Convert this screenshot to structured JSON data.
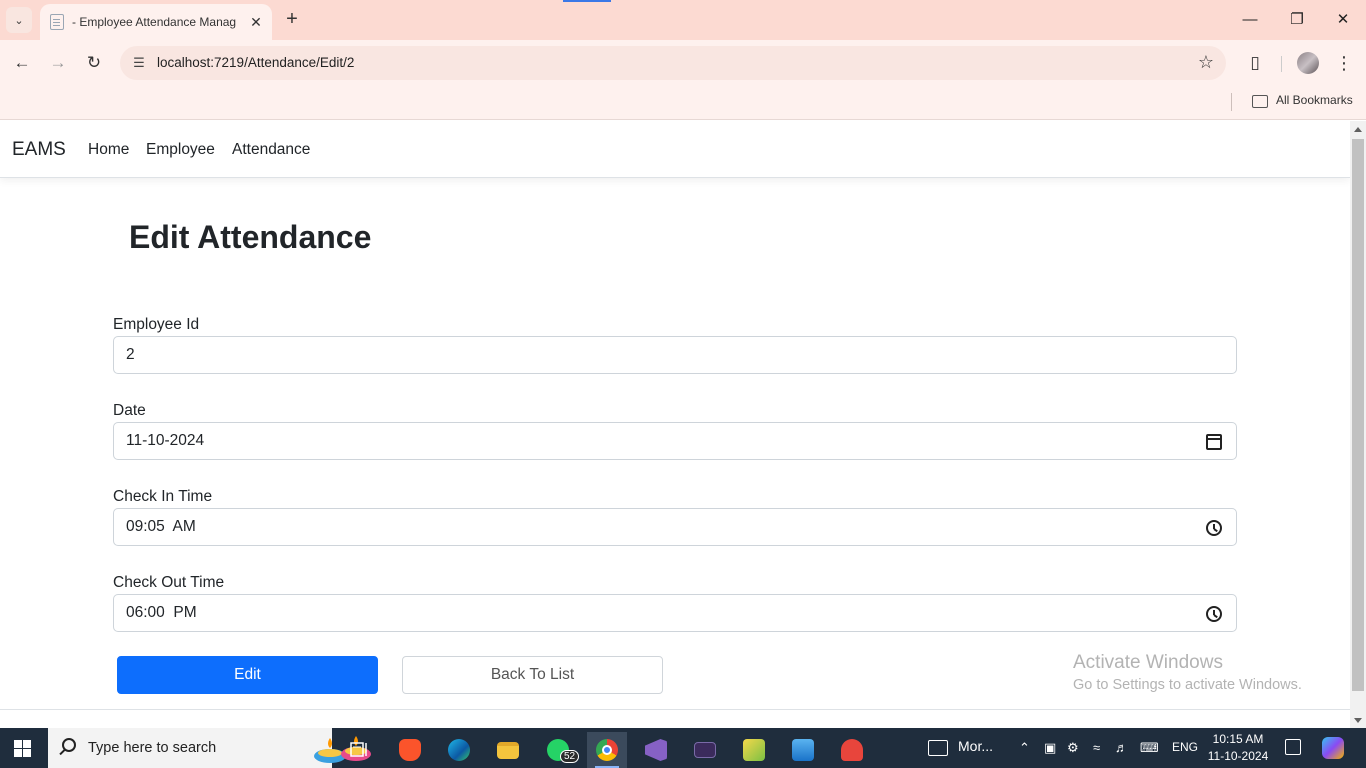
{
  "browser": {
    "tab_title": "- Employee Attendance Manag",
    "url": "localhost:7219/Attendance/Edit/2",
    "bookmarks_label": "All Bookmarks"
  },
  "navbar": {
    "brand": "EAMS",
    "links": [
      "Home",
      "Employee",
      "Attendance"
    ]
  },
  "page": {
    "title": "Edit Attendance",
    "fields": [
      {
        "label": "Employee Id",
        "value": "2",
        "icon": "none"
      },
      {
        "label": "Date",
        "value": "11-10-2024",
        "icon": "calendar-icon"
      },
      {
        "label": "Check In Time",
        "value": "09:05  AM",
        "icon": "clock-icon"
      },
      {
        "label": "Check Out Time",
        "value": "06:00  PM",
        "icon": "clock-icon"
      }
    ],
    "submit_label": "Edit",
    "back_label": "Back To List",
    "primary_color": "#0d6efd"
  },
  "watermark": {
    "title": "Activate Windows",
    "subtitle": "Go to Settings to activate Windows."
  },
  "taskbar": {
    "search_placeholder": "Type here to search",
    "whatsapp_badge": "52",
    "news_text": "Mor...",
    "language": "ENG",
    "time": "10:15 AM",
    "date": "11-10-2024"
  }
}
